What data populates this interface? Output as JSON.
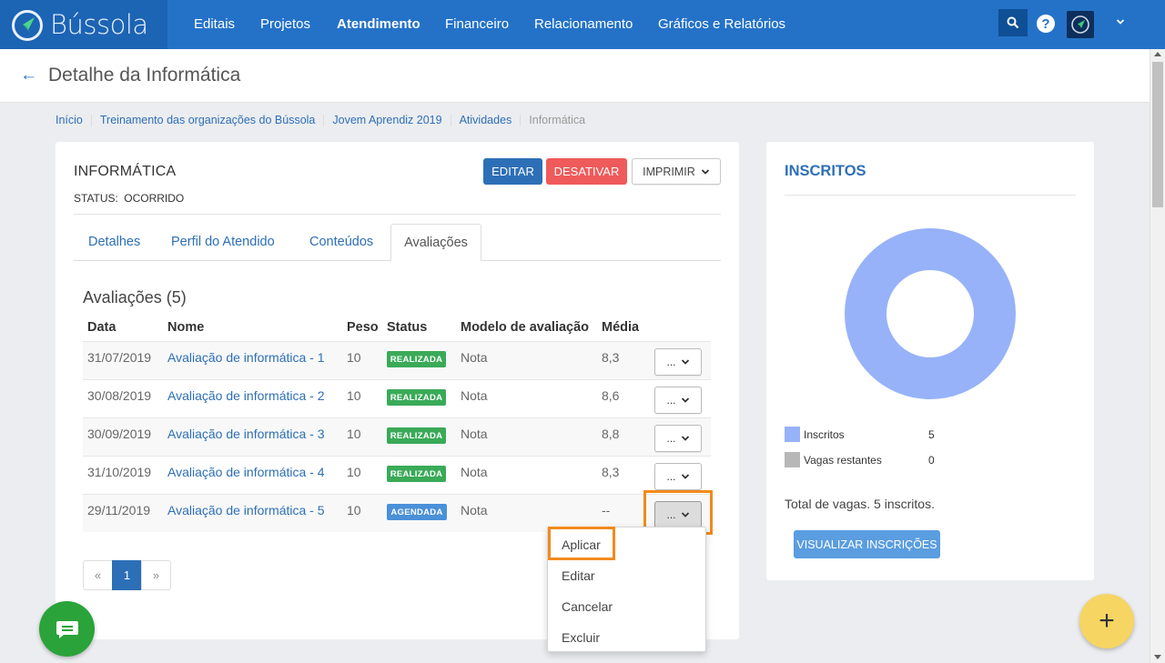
{
  "brand": {
    "name": "Bússola"
  },
  "nav": {
    "items": [
      {
        "label": "Editais",
        "bold": false
      },
      {
        "label": "Projetos",
        "bold": false
      },
      {
        "label": "Atendimento",
        "bold": true
      },
      {
        "label": "Financeiro",
        "bold": false
      },
      {
        "label": "Relacionamento",
        "bold": false
      },
      {
        "label": "Gráficos e Relatórios",
        "bold": false
      }
    ],
    "help_label": "?",
    "caret": "⌄"
  },
  "page": {
    "title": "Detalhe da Informática",
    "back_icon": "←"
  },
  "breadcrumb": [
    "Início",
    "Treinamento das organizações do Bússola",
    "Jovem Aprendiz 2019",
    "Atividades",
    "Informática"
  ],
  "activity": {
    "title": "INFORMÁTICA",
    "status_label": "STATUS:",
    "status_value": "OCORRIDO",
    "buttons": {
      "edit": "EDITAR",
      "deactivate": "DESATIVAR",
      "print": "IMPRIMIR"
    }
  },
  "tabs": [
    "Detalhes",
    "Perfil do Atendido",
    "Conteúdos",
    "Avaliações"
  ],
  "evaluations": {
    "title": "Avaliações (5)",
    "headers": [
      "Data",
      "Nome",
      "Peso",
      "Status",
      "Modelo de avaliação",
      "Média"
    ],
    "rows": [
      {
        "date": "31/07/2019",
        "name": "Avaliação de informática - 1",
        "weight": "10",
        "status": "REALIZADA",
        "model": "Nota",
        "avg": "8,3"
      },
      {
        "date": "30/08/2019",
        "name": "Avaliação de informática - 2",
        "weight": "10",
        "status": "REALIZADA",
        "model": "Nota",
        "avg": "8,6"
      },
      {
        "date": "30/09/2019",
        "name": "Avaliação de informática - 3",
        "weight": "10",
        "status": "REALIZADA",
        "model": "Nota",
        "avg": "8,8"
      },
      {
        "date": "31/10/2019",
        "name": "Avaliação de informática - 4",
        "weight": "10",
        "status": "REALIZADA",
        "model": "Nota",
        "avg": "8,3"
      },
      {
        "date": "29/11/2019",
        "name": "Avaliação de informática - 5",
        "weight": "10",
        "status": "AGENDADA",
        "model": "Nota",
        "avg": "--"
      }
    ],
    "action_label": "...",
    "pagination": {
      "prev": "«",
      "current": "1",
      "next": "»"
    }
  },
  "dropdown": {
    "items": [
      "Aplicar",
      "Editar",
      "Cancelar",
      "Excluir"
    ]
  },
  "inscritos": {
    "title": "INSCRITOS",
    "legend": [
      {
        "label": "Inscritos",
        "value": "5",
        "color": "#97b2f9"
      },
      {
        "label": "Vagas restantes",
        "value": "0",
        "color": "#b7b7b7"
      }
    ],
    "total_text": "Total de vagas. 5 inscritos.",
    "button": "VISUALIZAR INSCRIÇÕES"
  },
  "fab": {
    "label": "+"
  },
  "colors": {
    "primary": "#2472c8",
    "success": "#3aaa58",
    "danger": "#ef5a5a",
    "highlight": "#f28a1c",
    "chart": "#97b2f9"
  }
}
